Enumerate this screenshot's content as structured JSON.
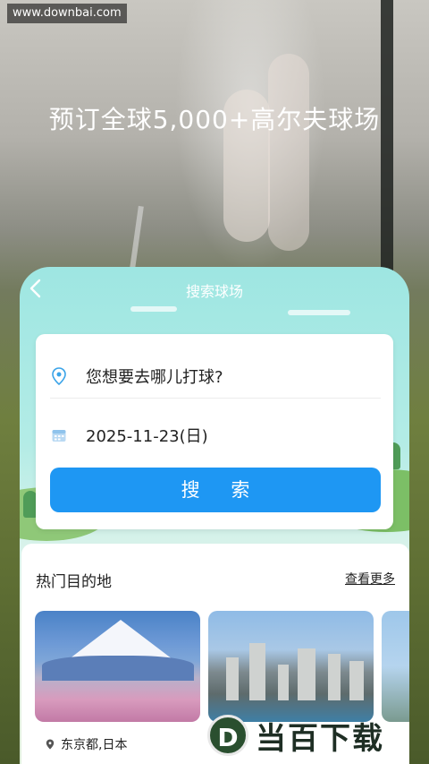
{
  "watermark": {
    "site": "www.downbai.com"
  },
  "hero": {
    "title": "预订全球5,000+高尔夫球场"
  },
  "search_card": {
    "title": "搜索球场",
    "location_placeholder": "您想要去哪儿打球?",
    "date": "2025-11-23(日)",
    "search_label": "搜 索"
  },
  "destinations": {
    "heading": "热门目的地",
    "more_label": "查看更多",
    "items": [
      {
        "location": "东京都,日本"
      }
    ]
  },
  "brand_watermark": {
    "logo_letter": "D",
    "name": "当百下载"
  },
  "colors": {
    "primary": "#1e97f3",
    "card_top": "#9ee6e2"
  }
}
